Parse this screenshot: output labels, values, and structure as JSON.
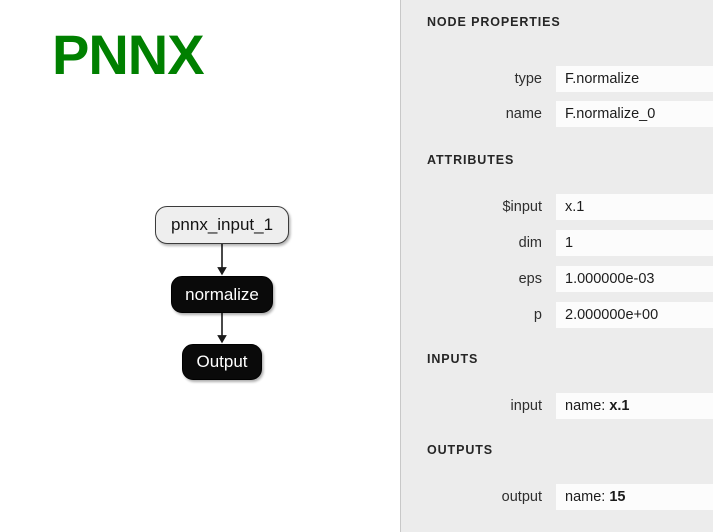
{
  "canvas": {
    "logo": "PNNX",
    "graph": {
      "nodes": [
        {
          "id": "pnnx_input_1",
          "label": "pnnx_input_1",
          "kind": "input"
        },
        {
          "id": "normalize",
          "label": "normalize",
          "kind": "op"
        },
        {
          "id": "output",
          "label": "Output",
          "kind": "op"
        }
      ]
    }
  },
  "panel": {
    "sections": {
      "node_properties": "NODE PROPERTIES",
      "attributes": "ATTRIBUTES",
      "inputs": "INPUTS",
      "outputs": "OUTPUTS"
    },
    "node_properties": [
      {
        "label": "type",
        "value": "F.normalize"
      },
      {
        "label": "name",
        "value": "F.normalize_0"
      }
    ],
    "attributes": [
      {
        "label": "$input",
        "value": "x.1"
      },
      {
        "label": "dim",
        "value": "1"
      },
      {
        "label": "eps",
        "value": "1.000000e-03"
      },
      {
        "label": "p",
        "value": "2.000000e+00"
      }
    ],
    "inputs": [
      {
        "label": "input",
        "prefix": "name:",
        "value": "x.1"
      }
    ],
    "outputs": [
      {
        "label": "output",
        "prefix": "name:",
        "value": "15"
      }
    ]
  },
  "colors": {
    "accent_green": "#008000",
    "panel_bg": "#ececec",
    "field_bg": "#fcfcfc",
    "node_op_bg": "#0a0a0a",
    "node_input_bg": "#eeeeee"
  }
}
